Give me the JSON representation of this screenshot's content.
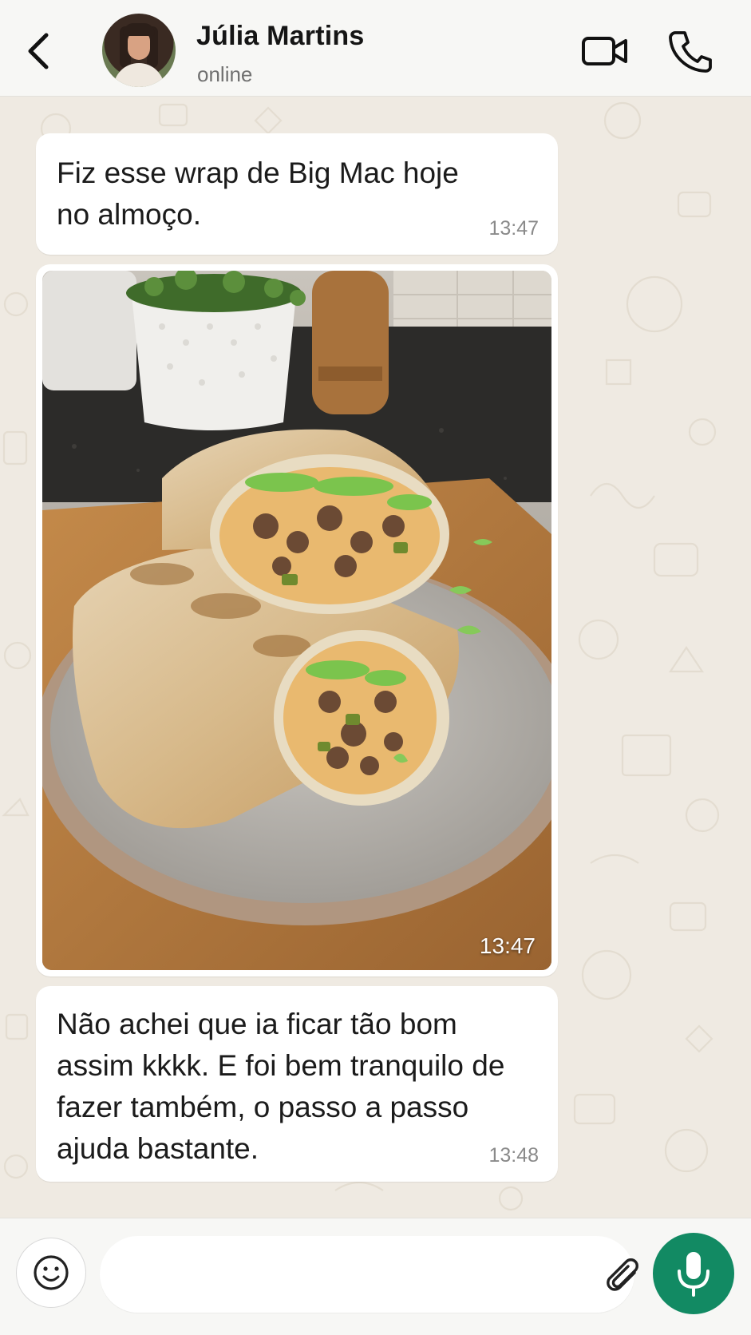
{
  "header": {
    "contact_name": "Júlia Martins",
    "status": "online",
    "back_icon": "chevron-left-icon",
    "video_icon": "video-camera-icon",
    "call_icon": "phone-icon"
  },
  "messages": [
    {
      "type": "text",
      "text": "Fiz esse wrap de Big Mac hoje\nno almoço.",
      "time": "13:47"
    },
    {
      "type": "image",
      "description_icon": "food-photo",
      "time": "13:47"
    },
    {
      "type": "text",
      "text": "Não achei que ia ficar tão bom\nassim kkkk. E foi bem tranquilo de\nfazer também, o passo a passo\najuda bastante.",
      "time": "13:48"
    }
  ],
  "composer": {
    "placeholder": "",
    "emoji_icon": "emoji-icon",
    "attach_icon": "paperclip-icon",
    "camera_icon": "camera-icon",
    "mic_icon": "microphone-icon"
  },
  "colors": {
    "accent": "#128a63",
    "chat_background": "#efeae2",
    "bubble": "#ffffff"
  }
}
